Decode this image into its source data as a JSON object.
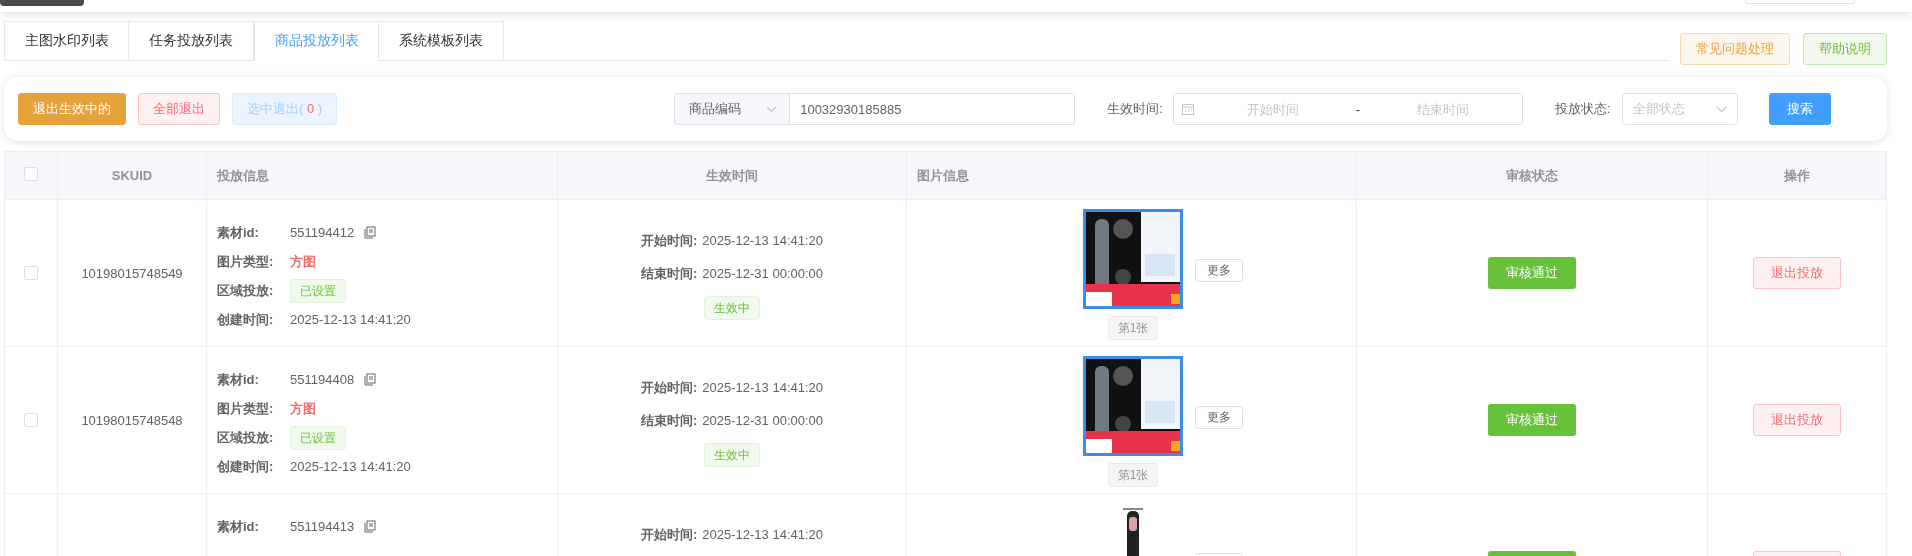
{
  "tabs": [
    {
      "label": "主图水印列表",
      "selected": false
    },
    {
      "label": "任务投放列表",
      "selected": false
    },
    {
      "label": "商品投放列表",
      "selected": true
    },
    {
      "label": "系统模板列表",
      "selected": false
    }
  ],
  "help_buttons": [
    {
      "label": "常见问题处理",
      "kind": "warning"
    },
    {
      "label": "帮助说明",
      "kind": "success"
    }
  ],
  "actions": {
    "exit_active": "退出生效中的",
    "exit_all": "全部退出",
    "exit_selected": {
      "prefix": "选中退出(",
      "count": "0",
      "suffix": ")",
      "disabled": true
    }
  },
  "search": {
    "field_type": "商品编码",
    "value": "10032930185885"
  },
  "date_range": {
    "label": "生效时间:",
    "start_placeholder": "开始时间",
    "separator": "-",
    "end_placeholder": "结束时间"
  },
  "status_filter": {
    "label": "投放状态:",
    "placeholder": "全部状态"
  },
  "search_button": "搜索",
  "table": {
    "header_checked": false,
    "columns": [
      "SKUID",
      "投放信息",
      "生效时间",
      "图片信息",
      "审核状态",
      "操作"
    ],
    "rows": [
      {
        "checked": false,
        "skuid": "10198015748549",
        "material_label": "素材id:",
        "material_id": "551194412",
        "type_label": "图片类型:",
        "type": "方图",
        "region_label": "区域投放:",
        "region": "已设置",
        "created_label": "创建时间:",
        "created": "2025-12-13 14:41:20",
        "start_label": "开始时间:",
        "start": "2025-12-13 14:41:20",
        "end_label": "结束时间:",
        "end": "2025-12-31 00:00:00",
        "status": "生效中",
        "more": "更多",
        "page": "第1张",
        "review": "审核通过",
        "action": "退出投放"
      },
      {
        "checked": false,
        "skuid": "10198015748548",
        "material_label": "素材id:",
        "material_id": "551194408",
        "type_label": "图片类型:",
        "type": "方图",
        "region_label": "区域投放:",
        "region": "已设置",
        "created_label": "创建时间:",
        "created": "2025-12-13 14:41:20",
        "start_label": "开始时间:",
        "start": "2025-12-13 14:41:20",
        "end_label": "结束时间:",
        "end": "2025-12-31 00:00:00",
        "status": "生效中",
        "more": "更多",
        "page": "第1张",
        "review": "审核通过",
        "action": "退出投放"
      },
      {
        "material_label": "素材id:",
        "material_id": "551194413",
        "start_label": "开始时间:",
        "start": "2025-12-13 14:41:20"
      }
    ]
  }
}
